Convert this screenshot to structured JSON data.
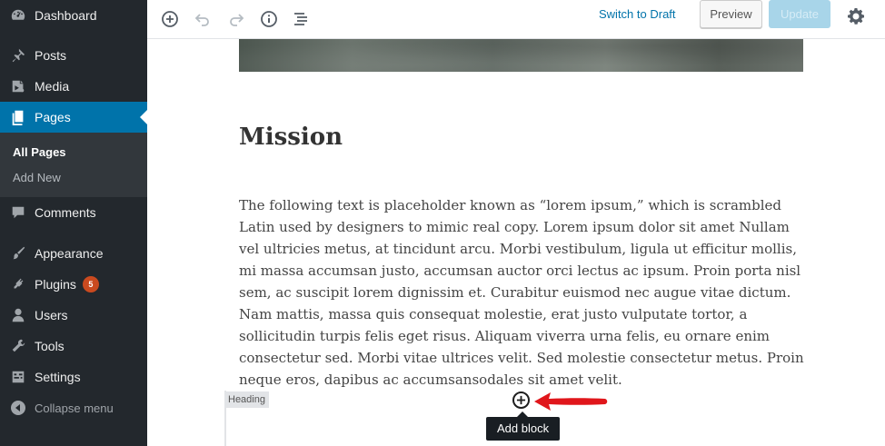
{
  "sidebar": {
    "items": [
      {
        "label": "Dashboard",
        "icon": "dashboard-icon"
      },
      {
        "label": "Posts",
        "icon": "pin-icon"
      },
      {
        "label": "Media",
        "icon": "media-icon"
      },
      {
        "label": "Pages",
        "icon": "pages-icon",
        "current": true
      },
      {
        "label": "Comments",
        "icon": "comment-icon"
      },
      {
        "label": "Appearance",
        "icon": "brush-icon"
      },
      {
        "label": "Plugins",
        "icon": "plug-icon",
        "badge": "5"
      },
      {
        "label": "Users",
        "icon": "user-icon"
      },
      {
        "label": "Tools",
        "icon": "wrench-icon"
      },
      {
        "label": "Settings",
        "icon": "settings-icon"
      }
    ],
    "submenu": [
      "All Pages",
      "Add New"
    ],
    "collapse_label": "Collapse menu"
  },
  "toolbar": {
    "icons": [
      "add-block-icon",
      "undo-icon",
      "redo-icon",
      "info-icon",
      "outline-icon"
    ],
    "switch_to_draft": "Switch to Draft",
    "preview": "Preview",
    "update": "Update",
    "settings_icon": "gear-icon"
  },
  "editor": {
    "heading": "Mission",
    "paragraph": "The following text is placeholder known as “lorem ipsum,” which is scrambled Latin used by designers to mimic real copy. Lorem ipsum dolor sit amet Nullam vel ultricies metus, at tincidunt arcu. Morbi vestibulum, ligula ut efficitur mollis, mi massa accumsan justo, accumsan auctor orci lectus ac ipsum. Proin porta nisl sem, ac suscipit lorem dignissim et. Curabitur euismod nec augue vitae dictum. Nam mattis, massa quis consequat molestie, erat justo vulputate tortor, a sollicitudin turpis felis eget risus. Aliquam viverra urna felis, eu ornare enim consectetur sed. Morbi vitae ultrices velit. Sed molestie consectetur metus. Proin neque eros, dapibus ac accumsansodales sit amet velit.",
    "block_label": "Heading",
    "add_block_tooltip": "Add block"
  },
  "colors": {
    "sidebar_bg": "#23282d",
    "active": "#0073aa",
    "badge": "#ca4a1f",
    "annotation_arrow": "#e0161b"
  }
}
